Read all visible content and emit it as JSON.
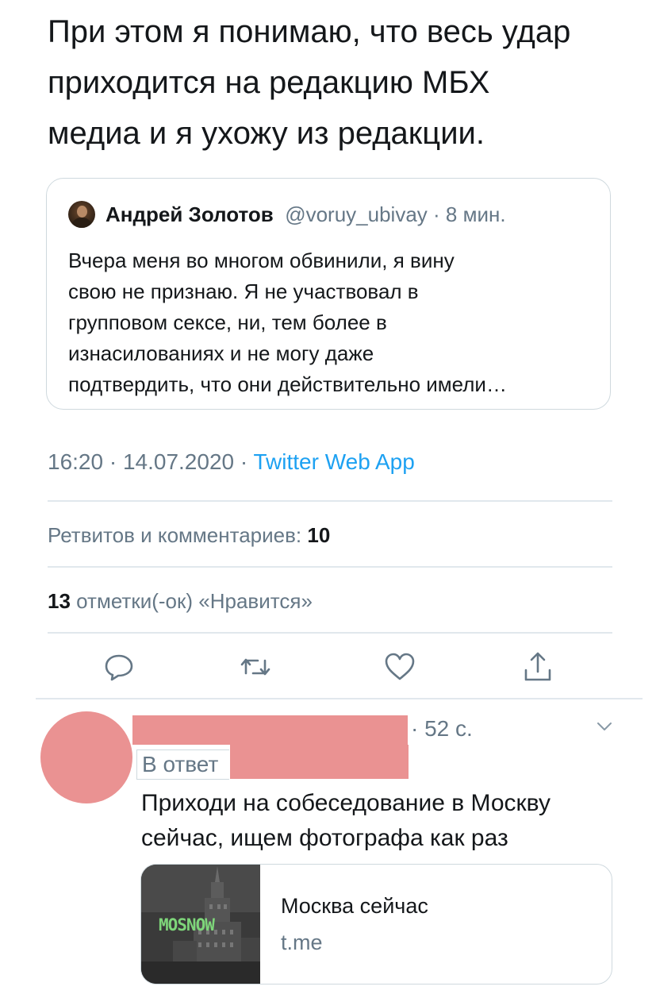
{
  "tweet": {
    "text_lines": [
      "При этом я понимаю, что весь удар",
      "приходится на редакцию МБХ",
      "медиа и я ухожу из редакции."
    ]
  },
  "quoted_tweet": {
    "author_name": "Андрей Золотов",
    "meta": "@voruy_ubivay · 8 мин.",
    "body_lines": [
      "Вчера меня во многом обвинили, я вину",
      "свою не признаю. Я не участвовал в",
      "групповом сексе, ни, тем более в",
      "изнасилованиях и не могу даже",
      "подтвердить, что они действительно имели…"
    ]
  },
  "timestamp": {
    "time_date": "16:20 · 14.07.2020 · ",
    "source": "Twitter Web App"
  },
  "stats": {
    "retweets_label": "Ретвитов и комментариев: ",
    "retweets_count": "10",
    "likes_count": "13",
    "likes_label": " отметки(-ок) «Нравится»"
  },
  "actions": {
    "icons": [
      "reply-icon",
      "retweet-icon",
      "like-icon",
      "share-icon"
    ],
    "color": "#657786"
  },
  "reply": {
    "time": "· 52 с.",
    "reply_to_label": "В ответ",
    "text_lines": [
      "Приходи на собеседование в Москву",
      "сейчас, ищем фотографа как раз"
    ],
    "redaction_color": "#ea9292"
  },
  "link_card": {
    "logo_text": "MOSNOW",
    "title": "Москва сейчас",
    "domain": "t.me"
  },
  "colors": {
    "text": "#14171a",
    "secondary": "#657786",
    "link": "#1da1f2",
    "border": "#cfd9de"
  }
}
